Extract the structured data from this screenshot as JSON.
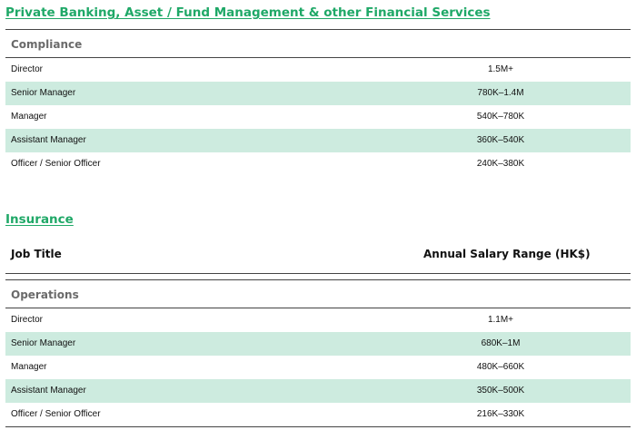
{
  "private_banking": {
    "title": "Private Banking, Asset / Fund Management & other Financial Services",
    "group": "Compliance",
    "rows": [
      {
        "job": "Director",
        "salary": "1.5M+"
      },
      {
        "job": "Senior Manager",
        "salary": "780K–1.4M"
      },
      {
        "job": "Manager",
        "salary": "540K–780K"
      },
      {
        "job": "Assistant Manager",
        "salary": "360K–540K"
      },
      {
        "job": "Officer / Senior Officer",
        "salary": "240K–380K"
      }
    ]
  },
  "insurance": {
    "title": "Insurance",
    "col_job": "Job Title",
    "col_salary": "Annual Salary Range (HK$)",
    "group": "Operations",
    "rows": [
      {
        "job": "Director",
        "salary": "1.1M+"
      },
      {
        "job": "Senior Manager",
        "salary": "680K–1M"
      },
      {
        "job": "Manager",
        "salary": "480K–660K"
      },
      {
        "job": "Assistant Manager",
        "salary": "350K–500K"
      },
      {
        "job": "Officer / Senior Officer",
        "salary": "216K–330K"
      }
    ]
  },
  "colors": {
    "title": "#1fa867",
    "row_shade": "#cdebdf",
    "group_text": "#6a6a6a"
  }
}
